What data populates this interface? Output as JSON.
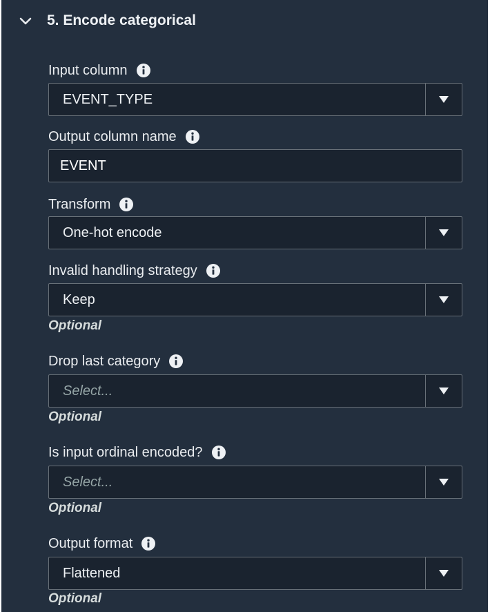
{
  "section": {
    "title": "5. Encode categorical",
    "collapse_icon": "chevron-down-icon"
  },
  "fields": {
    "input_column": {
      "label": "Input column",
      "value": "EVENT_TYPE"
    },
    "output_column_name": {
      "label": "Output column name",
      "value": "EVENT"
    },
    "transform": {
      "label": "Transform",
      "value": "One-hot encode"
    },
    "invalid_handling": {
      "label": "Invalid handling strategy",
      "value": "Keep",
      "hint": "Optional"
    },
    "drop_last_category": {
      "label": "Drop last category",
      "placeholder": "Select...",
      "hint": "Optional"
    },
    "is_input_ordinal": {
      "label": "Is input ordinal encoded?",
      "placeholder": "Select...",
      "hint": "Optional"
    },
    "output_format": {
      "label": "Output format",
      "value": "Flattened",
      "hint": "Optional"
    }
  },
  "icons": {
    "info": "info-icon",
    "dropdown": "caret-down-icon"
  },
  "colors": {
    "panel_background": "#232f3e",
    "control_background": "#1a232f",
    "control_border": "#687078",
    "text": "#e9ecef",
    "placeholder": "#95a5a6"
  }
}
